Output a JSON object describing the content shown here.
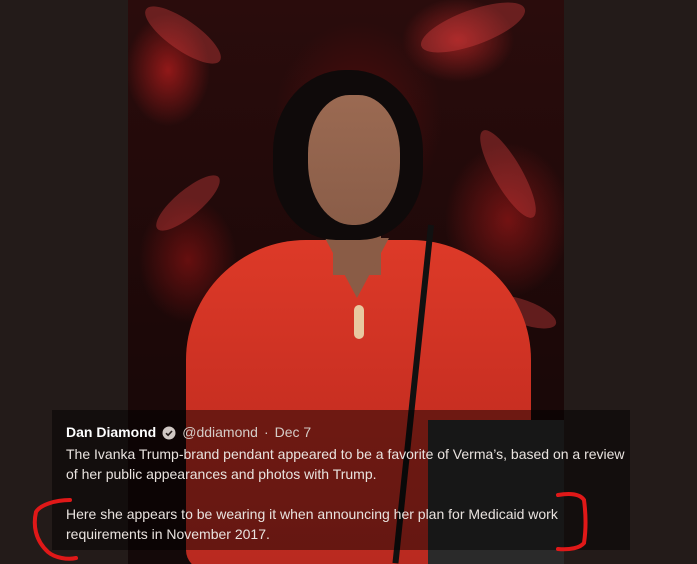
{
  "tweet": {
    "author_name": "Dan Diamond",
    "verified_icon": "verified-badge-icon",
    "handle": "@ddiamond",
    "separator": "·",
    "date": "Dec 7",
    "paragraph_1": "The Ivanka Trump-brand pendant appeared to be a favorite of Verma’s, based on a review of her public appearances and photos with Trump.",
    "paragraph_2": "Here she appears to be wearing it when announcing her plan for Medicaid work requirements in November 2017."
  },
  "colors": {
    "background": "#231b19",
    "annotation_red": "#e01818",
    "text": "#e9e3df"
  }
}
